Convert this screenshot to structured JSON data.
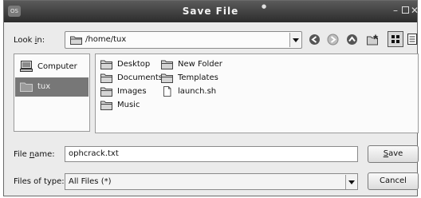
{
  "window": {
    "title": "Save File",
    "app_icon": "os-logo-icon",
    "app_icon_text": "OS"
  },
  "title_controls": [
    "minimize-icon",
    "maximize-icon",
    "close-icon"
  ],
  "look_in": {
    "label_pre": "Look ",
    "label_mnemonic": "i",
    "label_post": "n:",
    "path": "/home/tux"
  },
  "toolbar": [
    "back-icon",
    "forward-icon",
    "up-icon",
    "new-folder-icon",
    "icon-view-icon",
    "detail-view-icon"
  ],
  "places": [
    {
      "label": "Computer",
      "icon": "computer-icon",
      "selected": false
    },
    {
      "label": "tux",
      "icon": "folder-icon",
      "selected": true
    }
  ],
  "files": [
    {
      "label": "Desktop",
      "icon": "folder-icon"
    },
    {
      "label": "Documents",
      "icon": "folder-icon"
    },
    {
      "label": "Images",
      "icon": "folder-icon"
    },
    {
      "label": "Music",
      "icon": "folder-icon"
    },
    {
      "label": "New Folder",
      "icon": "folder-icon"
    },
    {
      "label": "Templates",
      "icon": "folder-icon"
    },
    {
      "label": "launch.sh",
      "icon": "file-icon"
    }
  ],
  "file_name": {
    "label_pre": "File ",
    "label_mnemonic": "n",
    "label_post": "ame:",
    "value": "ophcrack.txt"
  },
  "file_type": {
    "label": "Files of type:",
    "value": "All Files (*)"
  },
  "buttons": {
    "save_mnemonic": "S",
    "save_rest": "ave",
    "cancel": "Cancel"
  }
}
